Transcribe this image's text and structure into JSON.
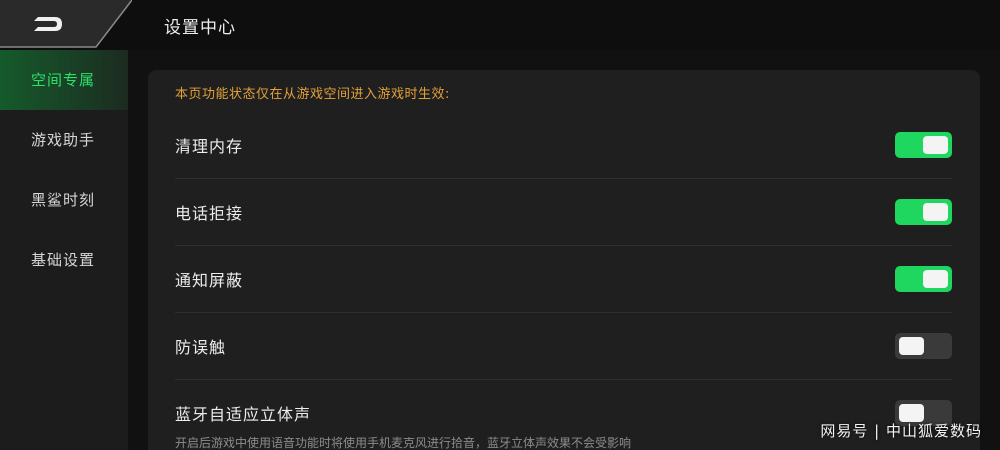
{
  "header": {
    "title": "设置中心",
    "back_icon": "back-arrow-icon"
  },
  "sidebar": {
    "items": [
      {
        "label": "空间专属",
        "active": true
      },
      {
        "label": "游戏助手",
        "active": false
      },
      {
        "label": "黑鲨时刻",
        "active": false
      },
      {
        "label": "基础设置",
        "active": false
      }
    ]
  },
  "main": {
    "notice": "本页功能状态仅在从游戏空间进入游戏时生效:",
    "settings": [
      {
        "label": "清理内存",
        "enabled": true
      },
      {
        "label": "电话拒接",
        "enabled": true
      },
      {
        "label": "通知屏蔽",
        "enabled": true
      },
      {
        "label": "防误触",
        "enabled": false
      },
      {
        "label": "蓝牙自适应立体声",
        "enabled": false,
        "description": "开启后游戏中使用语音功能时将使用手机麦克风进行拾音，蓝牙立体声效果不会受影响"
      }
    ]
  },
  "watermark": "网易号 | 中山狐爱数码",
  "colors": {
    "accent": "#1fd65f",
    "notice": "#e3a03a",
    "active_text": "#2ee06a"
  }
}
